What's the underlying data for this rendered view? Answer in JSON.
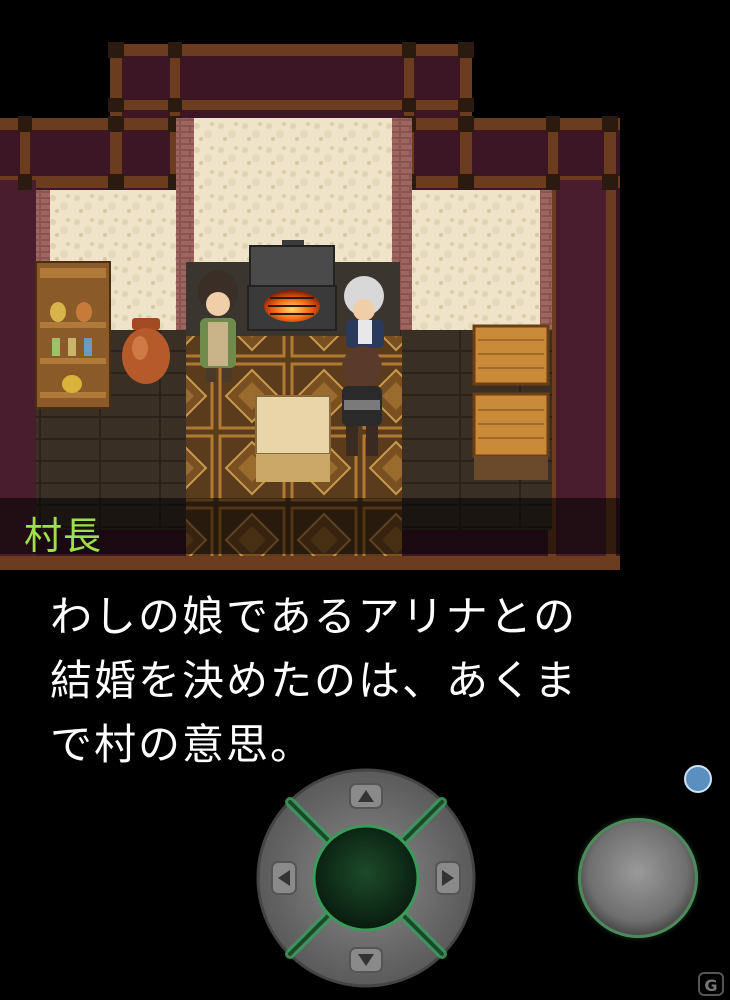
{
  "dialogue": {
    "speaker": "村長",
    "lines": [
      "わしの娘であるアリナとの",
      "結婚を決めたのは、あくま",
      "で村の意思。"
    ]
  },
  "controls": {
    "dpad_icons": [
      "arrow-up-icon",
      "arrow-down-icon",
      "arrow-left-icon",
      "arrow-right-icon"
    ],
    "action_button_icon": "action-button",
    "menu_icon": "menu-dot-icon"
  },
  "colors": {
    "speaker_name": "#9ee04a",
    "dialogue_text": "#ffffff",
    "dpad_glow": "#3a9a5a",
    "menu_dot": "#5a8fbf"
  }
}
